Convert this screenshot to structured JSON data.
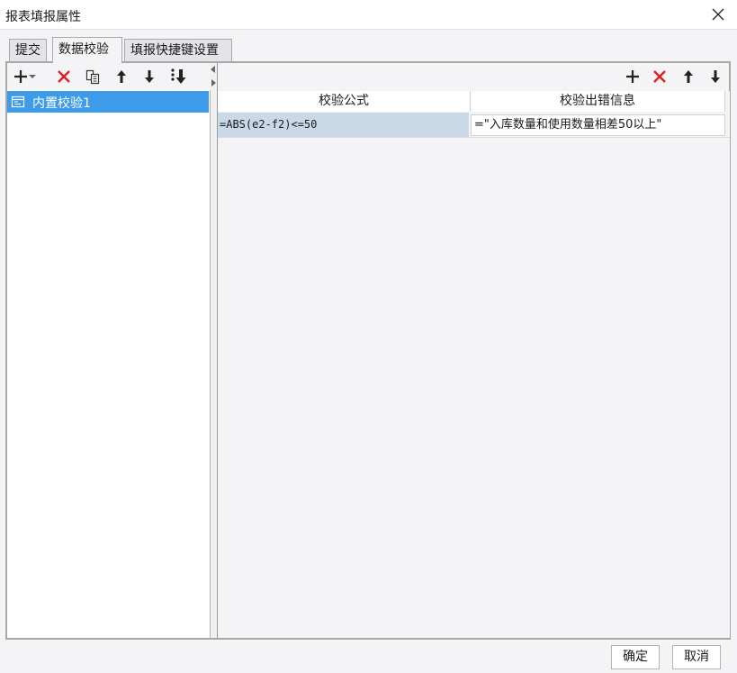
{
  "window": {
    "title": "报表填报属性"
  },
  "tabs": [
    {
      "label": "提交"
    },
    {
      "label": "数据校验"
    },
    {
      "label": "填报快捷键设置"
    }
  ],
  "left_toolbar": {
    "icons": [
      "add-icon",
      "chevron-down-icon",
      "delete-icon",
      "copy-icon",
      "move-up-icon",
      "move-down-icon",
      "reorder-icon"
    ],
    "colors": {
      "delete": "#e02020",
      "icon": "#222222"
    }
  },
  "tree": {
    "items": [
      {
        "label": "内置校验1",
        "selected": true
      }
    ],
    "colors": {
      "selection": "#3e9be9"
    }
  },
  "grid": {
    "headers": [
      "校验公式",
      "校验出错信息"
    ],
    "rows": [
      {
        "formula": "=ABS(e2-f2)<=50",
        "message": "=\"入库数量和使用数量相差50以上\""
      }
    ]
  },
  "footer": {
    "ok_label": "确定",
    "cancel_label": "取消"
  }
}
